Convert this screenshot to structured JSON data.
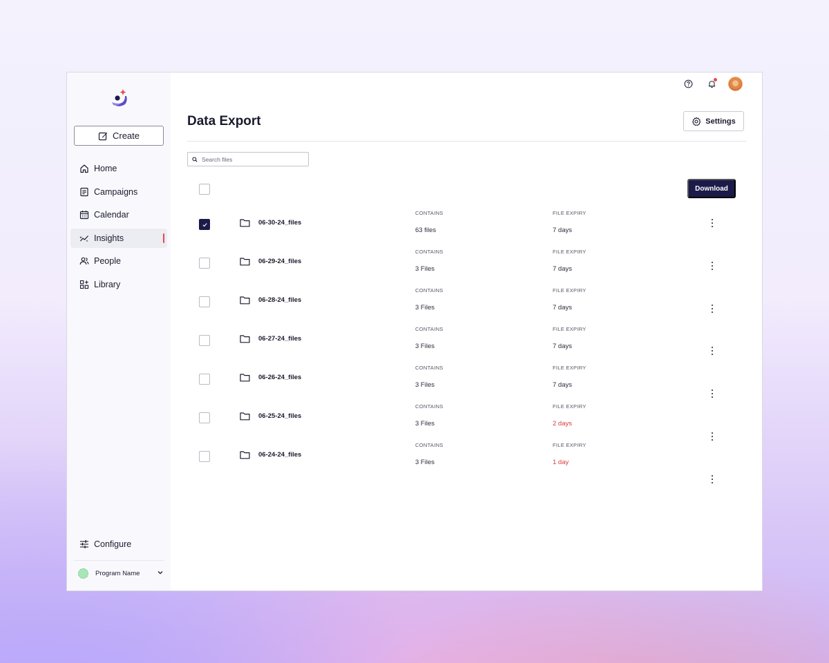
{
  "sidebar": {
    "create_label": "Create",
    "items": [
      {
        "label": "Home",
        "icon": "home-icon",
        "active": false
      },
      {
        "label": "Campaigns",
        "icon": "campaigns-icon",
        "active": false
      },
      {
        "label": "Calendar",
        "icon": "calendar-icon",
        "active": false
      },
      {
        "label": "Insights",
        "icon": "insights-icon",
        "active": true
      },
      {
        "label": "People",
        "icon": "people-icon",
        "active": false
      },
      {
        "label": "Library",
        "icon": "library-icon",
        "active": false
      }
    ],
    "configure_label": "Configure",
    "program_name": "Program Name"
  },
  "header": {
    "title": "Data Export",
    "settings_label": "Settings",
    "has_notification": true
  },
  "search": {
    "placeholder": "Search files"
  },
  "toolbar": {
    "download_label": "Download"
  },
  "colors": {
    "primary": "#1b1a48",
    "warning": "#d93b3b",
    "active_bar": "#e5484d"
  },
  "files": [
    {
      "name": "06-30-24_files",
      "contains_label": "CONTAINS",
      "contains": "63 files",
      "expiry_label": "FILE EXPIRY",
      "expiry": "7 days",
      "expiring_soon": false,
      "checked": true
    },
    {
      "name": "06-29-24_files",
      "contains_label": "CONTAINS",
      "contains": "3 Files",
      "expiry_label": "FILE EXPIRY",
      "expiry": "7 days",
      "expiring_soon": false,
      "checked": false
    },
    {
      "name": "06-28-24_files",
      "contains_label": "CONTAINS",
      "contains": "3 Files",
      "expiry_label": "FILE EXPIRY",
      "expiry": "7 days",
      "expiring_soon": false,
      "checked": false
    },
    {
      "name": "06-27-24_files",
      "contains_label": "CONTAINS",
      "contains": "3 Files",
      "expiry_label": "FILE EXPIRY",
      "expiry": "7 days",
      "expiring_soon": false,
      "checked": false
    },
    {
      "name": "06-26-24_files",
      "contains_label": "CONTAINS",
      "contains": "3 Files",
      "expiry_label": "FILE EXPIRY",
      "expiry": "7 days",
      "expiring_soon": false,
      "checked": false
    },
    {
      "name": "06-25-24_files",
      "contains_label": "CONTAINS",
      "contains": "3 Files",
      "expiry_label": "FILE EXPIRY",
      "expiry": "2 days",
      "expiring_soon": true,
      "checked": false
    },
    {
      "name": "06-24-24_files",
      "contains_label": "CONTAINS",
      "contains": "3 Files",
      "expiry_label": "FILE EXPIRY",
      "expiry": "1 day",
      "expiring_soon": true,
      "checked": false
    }
  ]
}
